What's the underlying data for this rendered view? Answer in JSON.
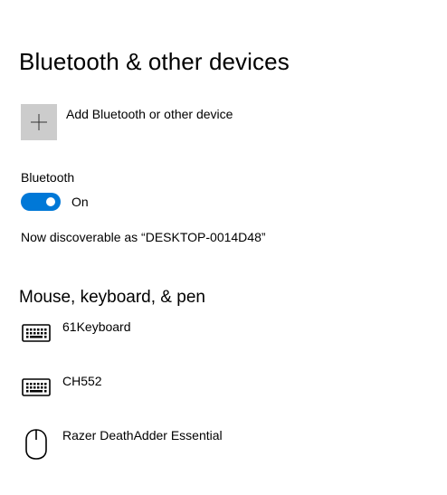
{
  "page": {
    "title": "Bluetooth & other devices"
  },
  "add_device": {
    "label": "Add Bluetooth or other device",
    "icon": "plus-icon"
  },
  "bluetooth": {
    "label": "Bluetooth",
    "toggle_state": "On",
    "toggle_on": true,
    "accent_color": "#0078d7",
    "discoverable_text": "Now discoverable as “DESKTOP-0014D48”"
  },
  "section": {
    "title": "Mouse, keyboard, & pen",
    "devices": [
      {
        "name": "61Keyboard",
        "icon": "keyboard-icon"
      },
      {
        "name": "CH552",
        "icon": "keyboard-icon"
      },
      {
        "name": "Razer DeathAdder Essential",
        "icon": "mouse-icon"
      }
    ]
  }
}
